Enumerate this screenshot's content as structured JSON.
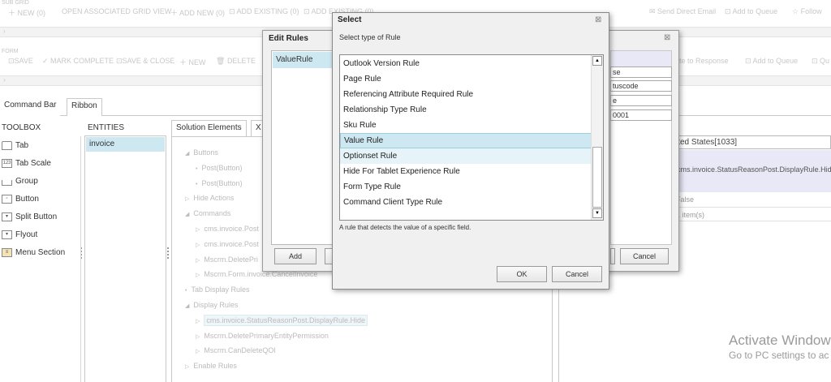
{
  "subgrid": {
    "label": "SUB GRID",
    "toolbar": [
      "NEW (0)",
      "OPEN ASSOCIATED GRID VIEW",
      "ADD NEW (0)",
      "ADD EXISTING (0)",
      "ADD EXISTING (0)",
      "Send Direct Email",
      "Add to Queue",
      "Follow"
    ]
  },
  "form": {
    "label": "FORM",
    "toolbar": [
      "SAVE",
      "MARK COMPLETE",
      "SAVE & CLOSE",
      "NEW",
      "DELETE"
    ],
    "right_items": [
      "ate to Response",
      "Add to Queue",
      "Qu"
    ]
  },
  "tabs": {
    "command_bar": "Command Bar",
    "ribbon": "Ribbon"
  },
  "toolbox": {
    "header": "TOOLBOX",
    "items": [
      "Tab",
      "Tab Scale",
      "Group",
      "Button",
      "Split Button",
      "Flyout",
      "Menu Section"
    ]
  },
  "entities": {
    "header": "ENTITIES",
    "items": [
      "invoice"
    ]
  },
  "solution_tabs": {
    "elements": "Solution Elements",
    "xml": "X"
  },
  "tree": [
    {
      "label": "Buttons",
      "kind": "expanded",
      "level": 0
    },
    {
      "label": "Post(Button)",
      "kind": "bullet",
      "level": 1
    },
    {
      "label": "Post(Button)",
      "kind": "bullet",
      "level": 1
    },
    {
      "label": "Hide Actions",
      "kind": "collapsed",
      "level": 0
    },
    {
      "label": "Commands",
      "kind": "expanded",
      "level": 0
    },
    {
      "label": "cms.invoice.Post",
      "kind": "collapsed",
      "level": 1
    },
    {
      "label": "cms.invoice.Post",
      "kind": "collapsed",
      "level": 1
    },
    {
      "label": "Mscrm.DeletePri",
      "kind": "collapsed",
      "level": 1
    },
    {
      "label": "Mscrm.Form.invoice.CancelInvoice",
      "kind": "collapsed",
      "level": 1
    },
    {
      "label": "Tab Display Rules",
      "kind": "bullet",
      "level": 0
    },
    {
      "label": "Display Rules",
      "kind": "expanded",
      "level": 0
    },
    {
      "label": "cms.invoice.StatusReasonPost.DisplayRule.Hide",
      "kind": "collapsed",
      "level": 1,
      "selected": true
    },
    {
      "label": "Mscrm.DeletePrimaryEntityPermission",
      "kind": "collapsed",
      "level": 1
    },
    {
      "label": "Mscrm.CanDeleteQOI",
      "kind": "collapsed",
      "level": 1
    },
    {
      "label": "Enable Rules",
      "kind": "collapsed",
      "level": 0
    }
  ],
  "right_panel": {
    "lang_value": "ited States[1033]",
    "display_rule_value": "cms.invoice.StatusReasonPost.DisplayRule.Hid",
    "false_value": "False",
    "items_value": "1 item(s)"
  },
  "edit_rules": {
    "title": "Edit Rules",
    "list": [
      "ValueRule"
    ],
    "add_label": "Add",
    "cancel_label": "Cancel",
    "fields": [
      "se",
      "tuscode",
      "e",
      "0001"
    ]
  },
  "select_dialog": {
    "title": "Select",
    "prompt": "Select type of Rule",
    "options": [
      "Outlook Version Rule",
      "Page Rule",
      "Referencing Attribute Required Rule",
      "Relationship Type Rule",
      "Sku Rule",
      "Value Rule",
      "Optionset Rule",
      "Hide For Tablet Experience  Rule",
      "Form Type Rule",
      "Command Client Type Rule"
    ],
    "selected": "Value Rule",
    "description": "A rule that detects the value of a specific field.",
    "ok_label": "OK",
    "cancel_label": "Cancel",
    "close_glyph": "⊠"
  },
  "watermark": {
    "line1": "Activate Window",
    "line2": "Go to PC settings to ac"
  },
  "colors": {
    "selection": "#cde8f1",
    "hover": "#e6f3f8",
    "dialog_bg": "#f0f0f0",
    "accent_border": "#9bcfe0"
  }
}
